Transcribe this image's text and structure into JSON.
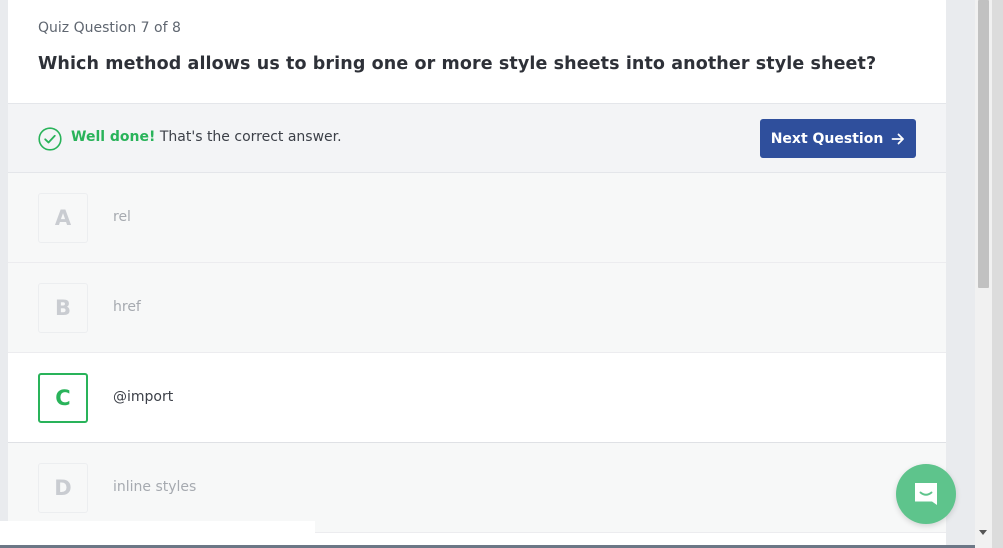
{
  "quiz": {
    "counter": "Quiz Question 7 of 8",
    "question": "Which method allows us to bring one or more style sheets into another style sheet?"
  },
  "feedback": {
    "strong": "Well done!",
    "message": " That's the correct answer.",
    "icon": "check-circle-icon",
    "accent_color": "#29b35a"
  },
  "next_button": {
    "label": "Next Question",
    "icon": "arrow-right-icon",
    "color": "#2f4f9c"
  },
  "answers": [
    {
      "letter": "A",
      "text": "rel",
      "correct": false
    },
    {
      "letter": "B",
      "text": "href",
      "correct": false
    },
    {
      "letter": "C",
      "text": "@import",
      "correct": true
    },
    {
      "letter": "D",
      "text": "inline styles",
      "correct": false
    }
  ],
  "chat": {
    "icon": "chat-icon",
    "color": "#5ec48c"
  }
}
